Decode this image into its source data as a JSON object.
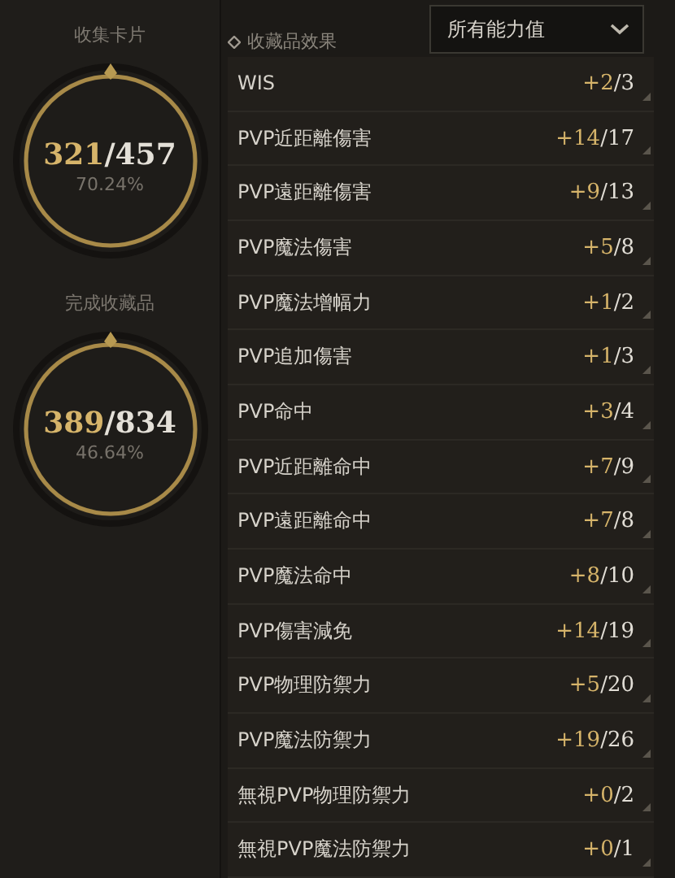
{
  "summary": [
    {
      "title": "收集卡片",
      "current": "321",
      "total": "/457",
      "percent": "70.24%"
    },
    {
      "title": "完成收藏品",
      "current": "389",
      "total": "/834",
      "percent": "46.64%"
    }
  ],
  "effects": {
    "title": "收藏品效果",
    "filter": "所有能力值",
    "rows": [
      {
        "name": "WIS",
        "value": "+2",
        "max": "/3"
      },
      {
        "name": "PVP近距離傷害",
        "value": "+14",
        "max": "/17"
      },
      {
        "name": "PVP遠距離傷害",
        "value": "+9",
        "max": "/13"
      },
      {
        "name": "PVP魔法傷害",
        "value": "+5",
        "max": "/8"
      },
      {
        "name": "PVP魔法增幅力",
        "value": "+1",
        "max": "/2"
      },
      {
        "name": "PVP追加傷害",
        "value": "+1",
        "max": "/3"
      },
      {
        "name": "PVP命中",
        "value": "+3",
        "max": "/4"
      },
      {
        "name": "PVP近距離命中",
        "value": "+7",
        "max": "/9"
      },
      {
        "name": "PVP遠距離命中",
        "value": "+7",
        "max": "/8"
      },
      {
        "name": "PVP魔法命中",
        "value": "+8",
        "max": "/10"
      },
      {
        "name": "PVP傷害減免",
        "value": "+14",
        "max": "/19"
      },
      {
        "name": "PVP物理防禦力",
        "value": "+5",
        "max": "/20"
      },
      {
        "name": "PVP魔法防禦力",
        "value": "+19",
        "max": "/26"
      },
      {
        "name": "無視PVP物理防禦力",
        "value": "+0",
        "max": "/2"
      },
      {
        "name": "無視PVP魔法防禦力",
        "value": "+0",
        "max": "/1"
      }
    ]
  }
}
